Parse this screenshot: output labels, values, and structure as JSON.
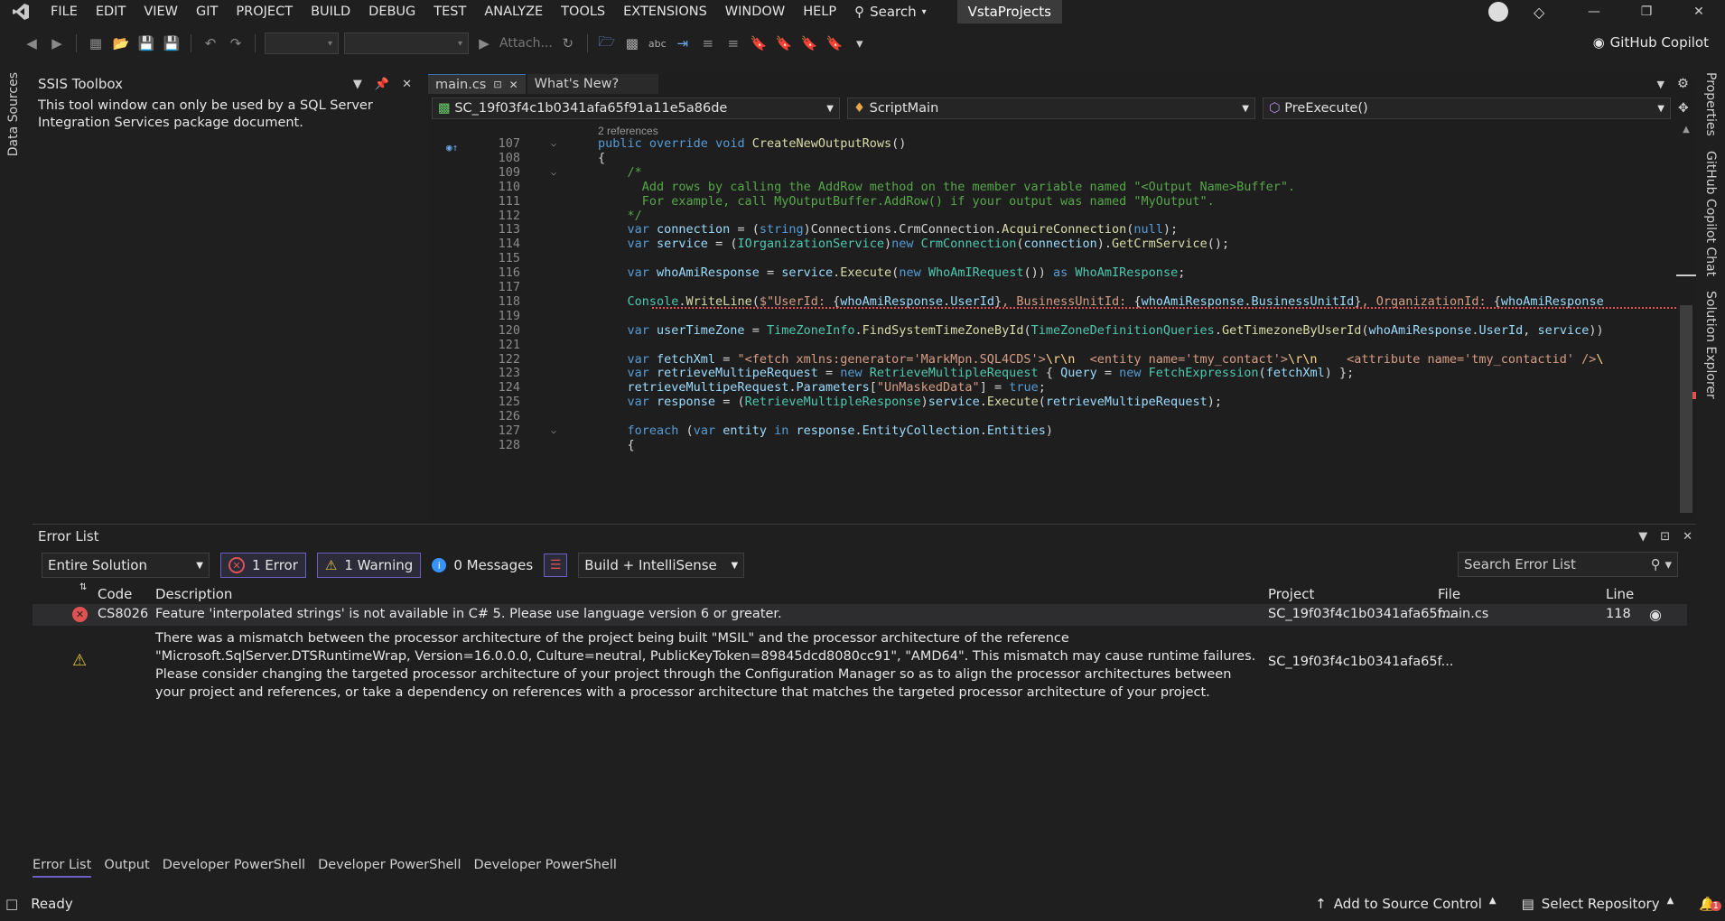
{
  "menu": {
    "items": [
      "FILE",
      "EDIT",
      "VIEW",
      "GIT",
      "PROJECT",
      "BUILD",
      "DEBUG",
      "TEST",
      "ANALYZE",
      "TOOLS",
      "EXTENSIONS",
      "WINDOW",
      "HELP"
    ],
    "search_label": "Search",
    "solution_name": "VstaProjects"
  },
  "toolbar": {
    "attach_label": "Attach...",
    "copilot_label": "GitHub Copilot"
  },
  "left_rail": {
    "label": "Data Sources"
  },
  "right_rail": {
    "items": [
      "Properties",
      "GitHub Copilot Chat",
      "Solution Explorer"
    ]
  },
  "toolbox": {
    "title": "SSIS Toolbox",
    "message": "This tool window can only be used by a SQL Server Integration Services package document."
  },
  "editor": {
    "tabs": [
      {
        "label": "main.cs"
      },
      {
        "label": "What's New?"
      }
    ],
    "nav": {
      "project": "SC_19f03f4c1b0341afa65f91a11e5a86de",
      "class": "ScriptMain",
      "member": "PreExecute()"
    },
    "references_label": "2 references",
    "lines": [
      {
        "n": "107",
        "tokens": [
          [
            "kw",
            "public "
          ],
          [
            "kw",
            "override "
          ],
          [
            "kw",
            "void "
          ],
          [
            "fn",
            "CreateNewOutputRows"
          ],
          [
            "pl",
            "()"
          ]
        ]
      },
      {
        "n": "108",
        "tokens": [
          [
            "pl",
            "{"
          ]
        ]
      },
      {
        "n": "109",
        "tokens": [
          [
            "cm",
            "    /*"
          ]
        ]
      },
      {
        "n": "110",
        "tokens": [
          [
            "cm",
            "      Add rows by calling the AddRow method on the member variable named \"<Output Name>Buffer\"."
          ]
        ]
      },
      {
        "n": "111",
        "tokens": [
          [
            "cm",
            "      For example, call MyOutputBuffer.AddRow() if your output was named \"MyOutput\"."
          ]
        ]
      },
      {
        "n": "112",
        "tokens": [
          [
            "cm",
            "    */"
          ]
        ]
      },
      {
        "n": "113",
        "tokens": [
          [
            "kw",
            "    var "
          ],
          [
            "va",
            "connection"
          ],
          [
            "pl",
            " = ("
          ],
          [
            "kw",
            "string"
          ],
          [
            "pl",
            ")Connections."
          ],
          [
            "pl",
            "CrmConnection."
          ],
          [
            "fn",
            "AcquireConnection"
          ],
          [
            "pl",
            "("
          ],
          [
            "kw",
            "null"
          ],
          [
            "pl",
            ");"
          ]
        ]
      },
      {
        "n": "114",
        "tokens": [
          [
            "kw",
            "    var "
          ],
          [
            "va",
            "service"
          ],
          [
            "pl",
            " = ("
          ],
          [
            "ty",
            "IOrganizationService"
          ],
          [
            "pl",
            ")"
          ],
          [
            "kw",
            "new "
          ],
          [
            "ty",
            "CrmConnection"
          ],
          [
            "pl",
            "("
          ],
          [
            "va",
            "connection"
          ],
          [
            "pl",
            ")."
          ],
          [
            "fn",
            "GetCrmService"
          ],
          [
            "pl",
            "();"
          ]
        ]
      },
      {
        "n": "115",
        "tokens": []
      },
      {
        "n": "116",
        "tokens": [
          [
            "kw",
            "    var "
          ],
          [
            "va",
            "whoAmiResponse"
          ],
          [
            "pl",
            " = "
          ],
          [
            "va",
            "service"
          ],
          [
            "pl",
            "."
          ],
          [
            "fn",
            "Execute"
          ],
          [
            "pl",
            "("
          ],
          [
            "kw",
            "new "
          ],
          [
            "ty",
            "WhoAmIRequest"
          ],
          [
            "pl",
            "()) "
          ],
          [
            "kw",
            "as "
          ],
          [
            "ty",
            "WhoAmIResponse"
          ],
          [
            "pl",
            ";"
          ]
        ]
      },
      {
        "n": "117",
        "tokens": []
      },
      {
        "n": "118",
        "tokens": [
          [
            "ty",
            "    Console"
          ],
          [
            "pl",
            "."
          ],
          [
            "fn",
            "WriteLine"
          ],
          [
            "pl",
            "("
          ],
          [
            "st",
            "$\"UserId: "
          ],
          [
            "pl",
            "{"
          ],
          [
            "va",
            "whoAmiResponse"
          ],
          [
            "pl",
            "."
          ],
          [
            "va",
            "UserId"
          ],
          [
            "pl",
            "}"
          ],
          [
            "st",
            ", BusinessUnitId: "
          ],
          [
            "pl",
            "{"
          ],
          [
            "va",
            "whoAmiResponse"
          ],
          [
            "pl",
            "."
          ],
          [
            "va",
            "BusinessUnitId"
          ],
          [
            "pl",
            "}"
          ],
          [
            "st",
            ", OrganizationId: "
          ],
          [
            "pl",
            "{"
          ],
          [
            "va",
            "whoAmiResponse"
          ]
        ]
      },
      {
        "n": "119",
        "tokens": []
      },
      {
        "n": "120",
        "tokens": [
          [
            "kw",
            "    var "
          ],
          [
            "va",
            "userTimeZone"
          ],
          [
            "pl",
            " = "
          ],
          [
            "ty",
            "TimeZoneInfo"
          ],
          [
            "pl",
            "."
          ],
          [
            "fn",
            "FindSystemTimeZoneById"
          ],
          [
            "pl",
            "("
          ],
          [
            "ty",
            "TimeZoneDefinitionQueries"
          ],
          [
            "pl",
            "."
          ],
          [
            "fn",
            "GetTimezoneByUserId"
          ],
          [
            "pl",
            "("
          ],
          [
            "va",
            "whoAmiResponse"
          ],
          [
            "pl",
            "."
          ],
          [
            "va",
            "UserId"
          ],
          [
            "pl",
            ", "
          ],
          [
            "va",
            "service"
          ],
          [
            "pl",
            "))"
          ]
        ]
      },
      {
        "n": "121",
        "tokens": []
      },
      {
        "n": "122",
        "tokens": [
          [
            "kw",
            "    var "
          ],
          [
            "va",
            "fetchXml"
          ],
          [
            "pl",
            " = "
          ],
          [
            "st",
            "\"<fetch xmlns:generator='MarkMpn.SQL4CDS'>"
          ],
          [
            "es",
            "\\r\\n"
          ],
          [
            "st",
            "  <entity name='tmy_contact'>"
          ],
          [
            "es",
            "\\r\\n"
          ],
          [
            "st",
            "    <attribute name='tmy_contactid' />"
          ],
          [
            "es",
            "\\"
          ]
        ]
      },
      {
        "n": "123",
        "tokens": [
          [
            "kw",
            "    var "
          ],
          [
            "va",
            "retrieveMultipeRequest"
          ],
          [
            "pl",
            " = "
          ],
          [
            "kw",
            "new "
          ],
          [
            "ty",
            "RetrieveMultipleRequest"
          ],
          [
            "pl",
            " { "
          ],
          [
            "va",
            "Query"
          ],
          [
            "pl",
            " = "
          ],
          [
            "kw",
            "new "
          ],
          [
            "ty",
            "FetchExpression"
          ],
          [
            "pl",
            "("
          ],
          [
            "va",
            "fetchXml"
          ],
          [
            "pl",
            ") };"
          ]
        ]
      },
      {
        "n": "124",
        "tokens": [
          [
            "va",
            "    retrieveMultipeRequest"
          ],
          [
            "pl",
            "."
          ],
          [
            "va",
            "Parameters"
          ],
          [
            "pl",
            "["
          ],
          [
            "st",
            "\"UnMaskedData\""
          ],
          [
            "pl",
            "] = "
          ],
          [
            "kw",
            "true"
          ],
          [
            "pl",
            ";"
          ]
        ]
      },
      {
        "n": "125",
        "tokens": [
          [
            "kw",
            "    var "
          ],
          [
            "va",
            "response"
          ],
          [
            "pl",
            " = ("
          ],
          [
            "ty",
            "RetrieveMultipleResponse"
          ],
          [
            "pl",
            ")"
          ],
          [
            "va",
            "service"
          ],
          [
            "pl",
            "."
          ],
          [
            "fn",
            "Execute"
          ],
          [
            "pl",
            "("
          ],
          [
            "va",
            "retrieveMultipeRequest"
          ],
          [
            "pl",
            ");"
          ]
        ]
      },
      {
        "n": "126",
        "tokens": []
      },
      {
        "n": "127",
        "tokens": [
          [
            "kw",
            "    foreach "
          ],
          [
            "pl",
            "("
          ],
          [
            "kw",
            "var "
          ],
          [
            "va",
            "entity"
          ],
          [
            "kw",
            " in "
          ],
          [
            "va",
            "response"
          ],
          [
            "pl",
            "."
          ],
          [
            "va",
            "EntityCollection"
          ],
          [
            "pl",
            "."
          ],
          [
            "va",
            "Entities"
          ],
          [
            "pl",
            ")"
          ]
        ]
      },
      {
        "n": "128",
        "tokens": [
          [
            "pl",
            "    {"
          ]
        ]
      }
    ]
  },
  "error_list": {
    "title": "Error List",
    "scope": "Entire Solution",
    "errors_filter": "1 Error",
    "warnings_filter": "1 Warning",
    "messages_filter": "0 Messages",
    "build_filter": "Build + IntelliSense",
    "search_placeholder": "Search Error List",
    "columns": {
      "code": "Code",
      "description": "Description",
      "project": "Project",
      "file": "File",
      "line": "Line"
    },
    "rows": [
      {
        "severity": "error",
        "code": "CS8026",
        "description": "Feature 'interpolated strings' is not available in C# 5. Please use language version 6 or greater.",
        "project": "SC_19f03f4c1b0341afa65f...",
        "file": "main.cs",
        "line": "118"
      },
      {
        "severity": "warning",
        "code": "",
        "description": "There was a mismatch between the processor architecture of the project being built \"MSIL\" and the processor architecture of the reference \"Microsoft.SqlServer.DTSRuntimeWrap, Version=16.0.0.0, Culture=neutral, PublicKeyToken=89845dcd8080cc91\", \"AMD64\". This mismatch may cause runtime failures. Please consider changing the targeted processor architecture of your project through the Configuration Manager so as to align the processor architectures between your project and references, or take a dependency on references with a processor architecture that matches the targeted processor architecture of your project.",
        "project": "SC_19f03f4c1b0341afa65f...",
        "file": "",
        "line": ""
      }
    ]
  },
  "bottom_tabs": [
    "Error List",
    "Output",
    "Developer PowerShell",
    "Developer PowerShell",
    "Developer PowerShell"
  ],
  "status": {
    "ready": "Ready",
    "source_control": "Add to Source Control",
    "repository": "Select Repository",
    "notifications": "1"
  },
  "colors": {
    "accent": "#6b5fbf",
    "error": "#e05252",
    "warning": "#e8c33d",
    "info": "#3794ff"
  }
}
